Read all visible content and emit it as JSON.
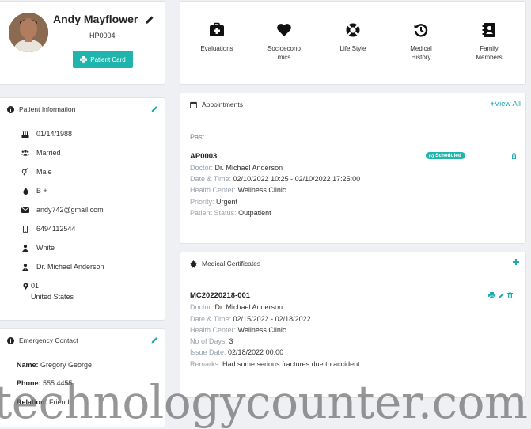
{
  "profile": {
    "name": "Andy Mayflower",
    "id": "HP0004",
    "button_label": "Patient Card"
  },
  "nav": [
    {
      "label": "Evaluations",
      "icon": "medical-kit-icon"
    },
    {
      "label": "Socioecono\nmics",
      "icon": "heart-icon"
    },
    {
      "label": "Life Style",
      "icon": "life-ring-icon"
    },
    {
      "label": "Medical\nHistory",
      "icon": "history-icon"
    },
    {
      "label": "Family\nMembers",
      "icon": "address-book-icon"
    }
  ],
  "patient_info": {
    "title": "Patient Information",
    "dob": "01/14/1988",
    "marital": "Married",
    "gender": "Male",
    "blood": "B +",
    "email": "andy742@gmail.com",
    "phone": "6494112544",
    "race": "White",
    "doctor": "Dr. Michael Anderson",
    "address_line1": "01",
    "address_line2": "United States"
  },
  "emergency": {
    "title": "Emergency Contact",
    "name_label": "Name:",
    "name_value": "Gregory George",
    "phone_label": "Phone:",
    "phone_value": "555 4455",
    "relation_label": "Relation:",
    "relation_value": "Friend"
  },
  "appointments": {
    "title": "Appointments",
    "view_all": "View All",
    "section": "Past",
    "item": {
      "code": "AP0003",
      "status_badge": "Scheduled",
      "doctor_label": "Doctor:",
      "doctor": "Dr. Michael Anderson",
      "datetime_label": "Date & Time:",
      "datetime": "02/10/2022 10:25 - 02/10/2022 17:25:00",
      "center_label": "Health Center:",
      "center": "Wellness Clinic",
      "priority_label": "Priority:",
      "priority": "Urgent",
      "pstatus_label": "Patient Status:",
      "pstatus": "Outpatient"
    }
  },
  "certificates": {
    "title": "Medical Certificates",
    "item": {
      "code": "MC20220218-001",
      "doctor_label": "Doctor:",
      "doctor": "Dr. Michael Anderson",
      "datetime_label": "Date & Time:",
      "datetime": "02/15/2022 - 02/18/2022",
      "center_label": "Health Center:",
      "center": "Wellness Clinic",
      "days_label": "No of Days:",
      "days": "3",
      "issue_label": "Issue Date:",
      "issue": "02/18/2022 00:00",
      "remarks_label": "Remarks:",
      "remarks": "Had some serious fractures due to accident."
    }
  },
  "watermark": "technologycounter.com",
  "colors": {
    "accent": "#1fa9b0",
    "button": "#1fb5ad",
    "background": "#eef0f3"
  }
}
